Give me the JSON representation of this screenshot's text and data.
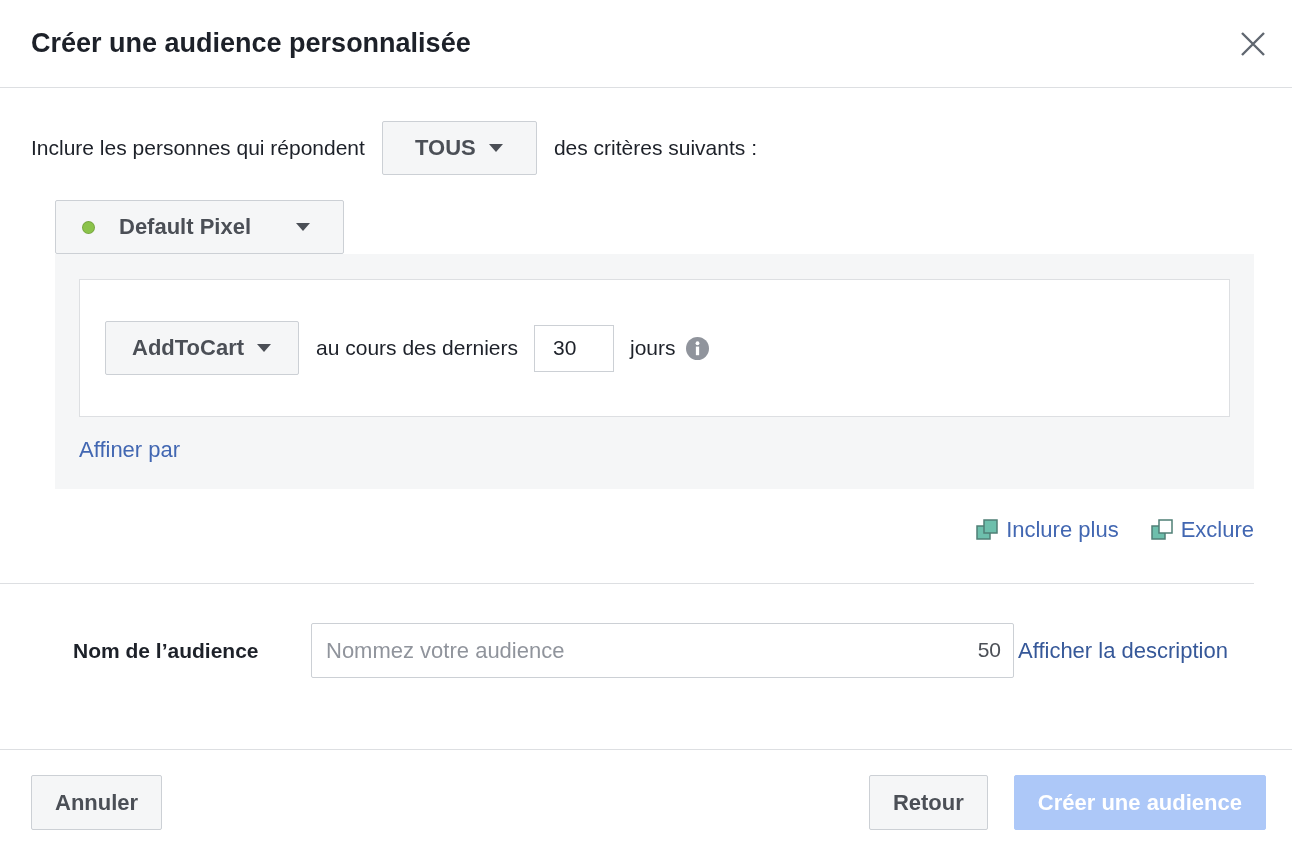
{
  "dialog": {
    "title": "Créer une audience personnalisée"
  },
  "rule": {
    "prefix": "Inclure les personnes qui répondent",
    "match_dropdown": "TOUS",
    "suffix": "des critères suivants :"
  },
  "source": {
    "label": "Default Pixel",
    "color": "#8bc34a"
  },
  "event": {
    "dropdown": "AddToCart",
    "prefix": "au cours des derniers",
    "days": "30",
    "unit": "jours"
  },
  "refine_link": "Affiner par",
  "actions": [
    {
      "label": "Inclure plus",
      "kind": "include"
    },
    {
      "label": "Exclure",
      "kind": "exclude"
    }
  ],
  "name_field": {
    "label": "Nom de l’audience",
    "placeholder": "Nommez votre audience",
    "counter": "50",
    "link": "Afficher la description"
  },
  "footer": {
    "buttons": [
      {
        "label": "Annuler",
        "kind": "cancel",
        "disabled": false
      },
      {
        "label": "Retour",
        "kind": "back",
        "disabled": false
      },
      {
        "label": "Créer une audience",
        "kind": "primary",
        "disabled": true
      }
    ]
  }
}
